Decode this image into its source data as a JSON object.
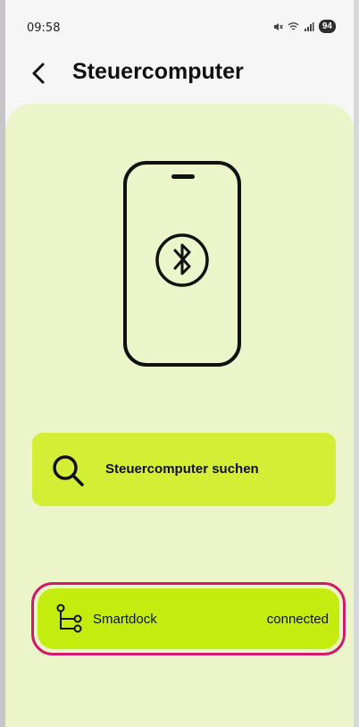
{
  "status_bar": {
    "time": "09:58",
    "signal_text": "✖ ≈ .∣∣",
    "battery": "94"
  },
  "header": {
    "title": "Steuercomputer"
  },
  "actions": {
    "search_label": "Steuercomputer suchen"
  },
  "devices": [
    {
      "name": "Smartdock",
      "status": "connected"
    }
  ],
  "colors": {
    "card_bg": "#ecf4c9",
    "search_button_bg": "#d4ee36",
    "device_bg": "#c4ec0e",
    "highlight_border": "#d6176e"
  }
}
